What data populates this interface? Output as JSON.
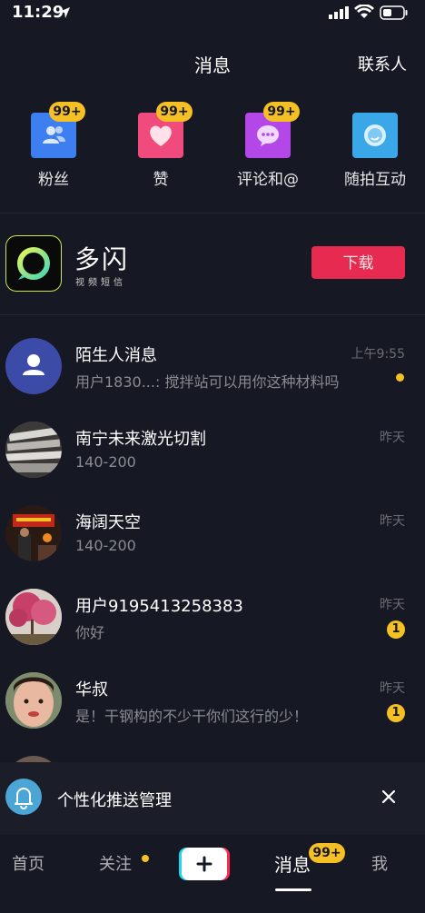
{
  "status_bar": {
    "time": "11:29"
  },
  "header": {
    "title": "消息",
    "contacts": "联系人"
  },
  "quick_actions": [
    {
      "label": "粉丝",
      "badge": "99+",
      "icon": "fans-icon",
      "color": "#3d7ef0"
    },
    {
      "label": "赞",
      "badge": "99+",
      "icon": "heart-icon",
      "color": "#f04b7c"
    },
    {
      "label": "评论和@",
      "badge": "99+",
      "icon": "comment-icon",
      "color": "#b447e8"
    },
    {
      "label": "随拍互动",
      "badge": "",
      "icon": "camera-bubble-icon",
      "color": "#3aa8e8"
    }
  ],
  "promo": {
    "app_name": "多闪",
    "app_sub": "视频短信",
    "button_label": "下载"
  },
  "messages": [
    {
      "name": "陌生人消息",
      "preview": "用户1830...: 搅拌站可以用你这种材料吗",
      "time": "上午9:55",
      "unread": "dot",
      "avatar": "stranger"
    },
    {
      "name": "南宁未来激光切割",
      "preview": "140-200",
      "time": "昨天",
      "unread": "",
      "avatar": "newspaper"
    },
    {
      "name": "海阔天空",
      "preview": "140-200",
      "time": "昨天",
      "unread": "",
      "avatar": "stage"
    },
    {
      "name": "用户9195413258383",
      "preview": "你好",
      "time": "昨天",
      "unread": "1",
      "avatar": "tree"
    },
    {
      "name": "华叔",
      "preview": "是！干钢构的不少干你们这行的少！",
      "time": "昨天",
      "unread": "1",
      "avatar": "child"
    }
  ],
  "push_bar": {
    "text": "个性化推送管理"
  },
  "tabbar": {
    "home": "首页",
    "follow": "关注",
    "messages": "消息",
    "messages_badge": "99+",
    "me": "我"
  },
  "colors": {
    "background": "#161823",
    "accent_yellow": "#f5c023",
    "accent_red": "#fe2c55"
  }
}
